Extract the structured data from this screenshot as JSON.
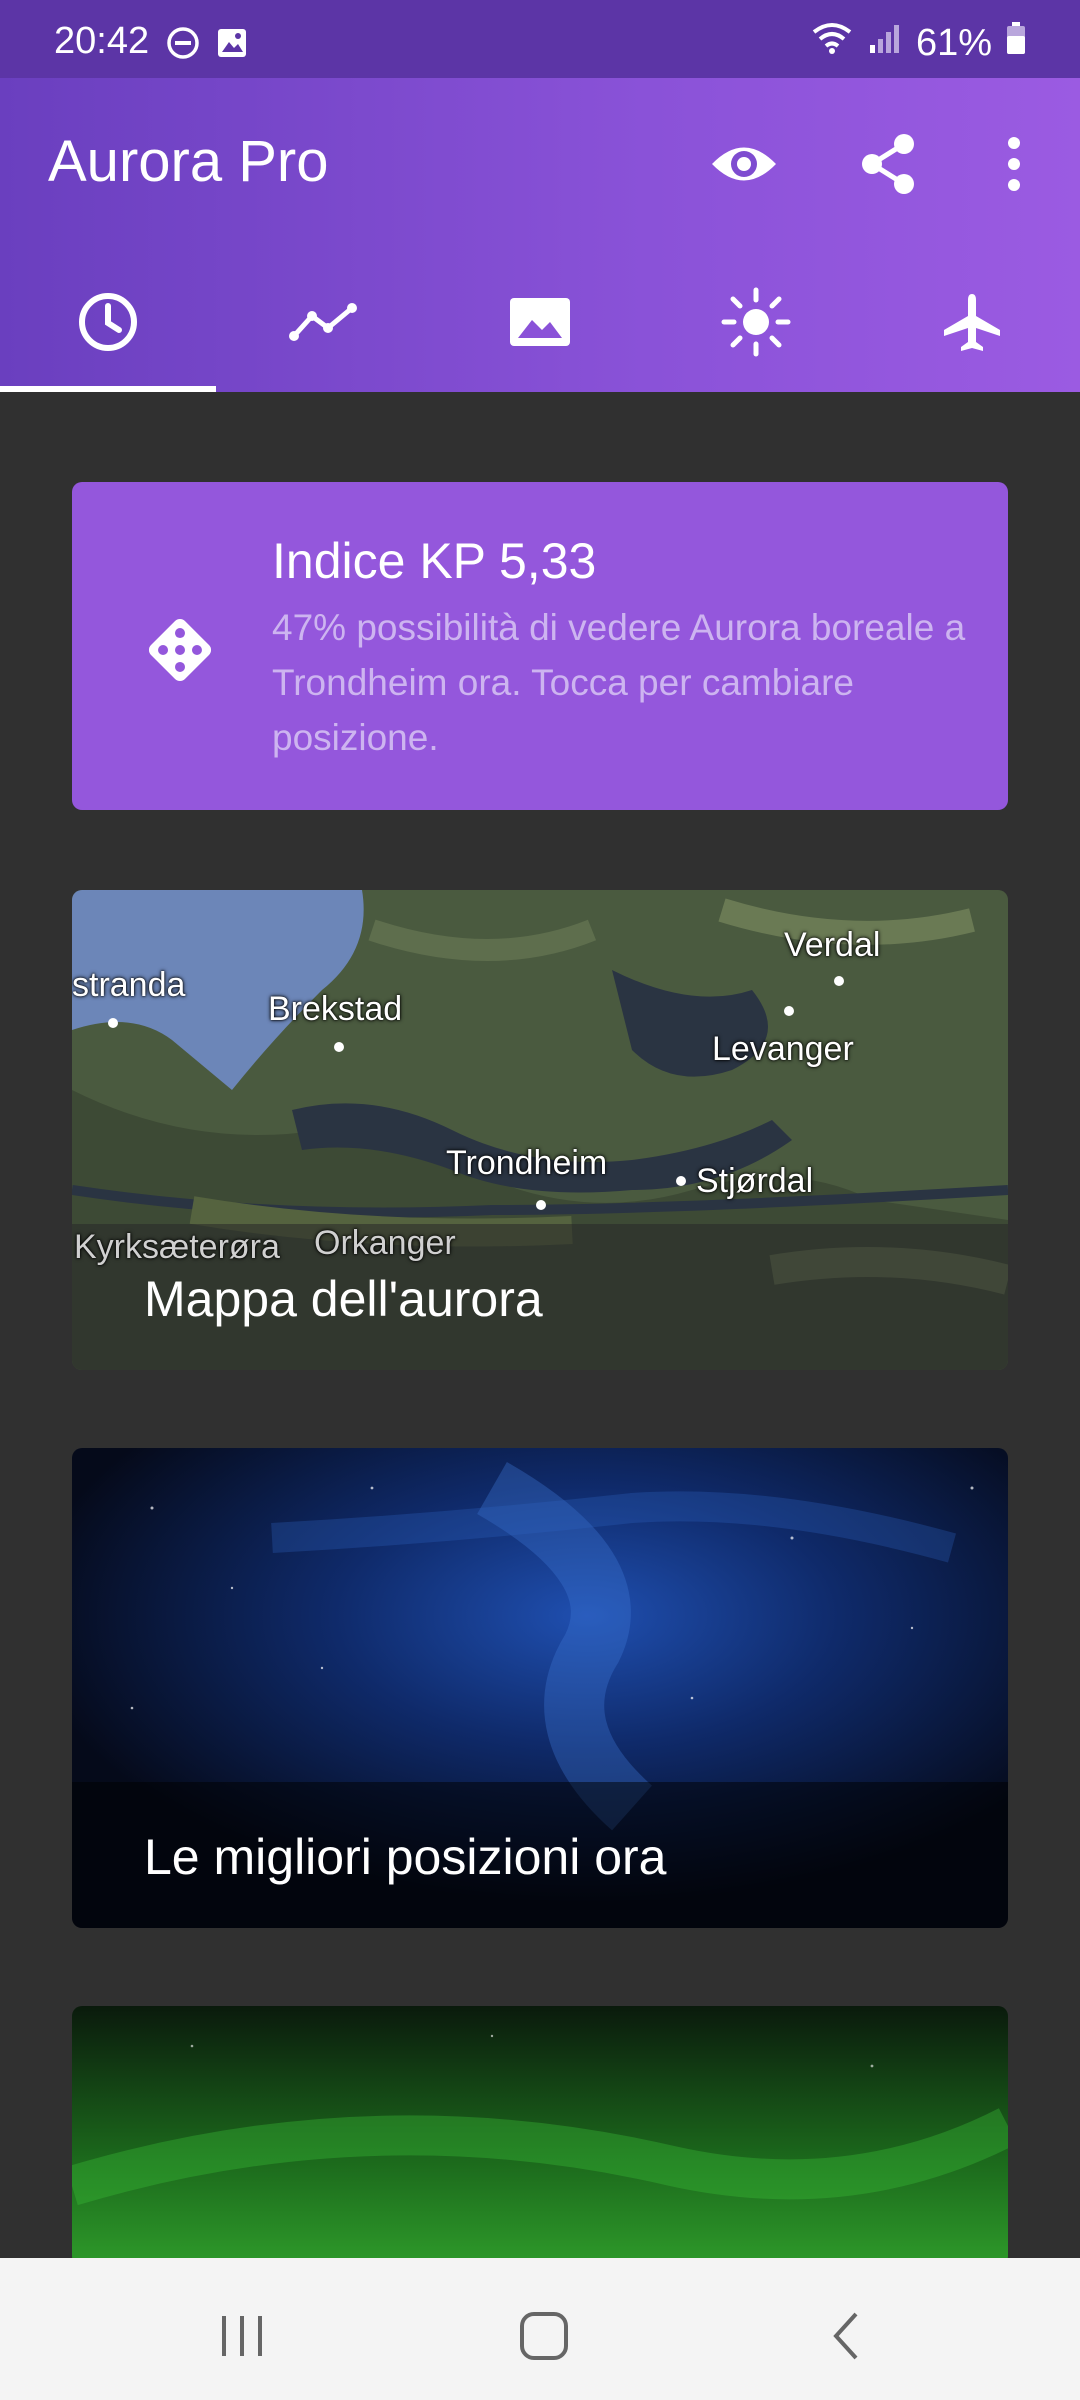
{
  "status_bar": {
    "time": "20:42",
    "battery": "61%",
    "icons": [
      "do-not-disturb-icon",
      "image-notification-icon",
      "wifi-icon",
      "signal-icon",
      "battery-icon"
    ]
  },
  "app_bar": {
    "title": "Aurora Pro",
    "actions": [
      "eye-icon",
      "share-icon",
      "more-vert-icon"
    ]
  },
  "tabs": [
    {
      "icon": "clock-icon",
      "selected": true
    },
    {
      "icon": "chart-line-icon",
      "selected": false
    },
    {
      "icon": "image-icon",
      "selected": false
    },
    {
      "icon": "sun-icon",
      "selected": false
    },
    {
      "icon": "airplane-icon",
      "selected": false
    }
  ],
  "kp_card": {
    "icon": "dice-icon",
    "title": "Indice KP 5,33",
    "description": "47% possibilità di vedere Aurora boreale a Trondheim ora. Tocca per cambiare posizione."
  },
  "map_card": {
    "title": "Mappa dell'aurora",
    "places": [
      "stranda",
      "Brekstad",
      "Verdal",
      "Levanger",
      "Trondheim",
      "Stjørdal",
      "Kyrksæterøra",
      "Orkanger"
    ]
  },
  "locations_card": {
    "title": "Le migliori posizioni ora"
  },
  "nav_bar": {
    "buttons": [
      "recent-apps-icon",
      "home-icon",
      "back-icon"
    ]
  },
  "colors": {
    "app_bar": "#7a48cc",
    "kp_card": "#9457dc",
    "background": "#303030",
    "status_bar": "#5c35a6"
  }
}
